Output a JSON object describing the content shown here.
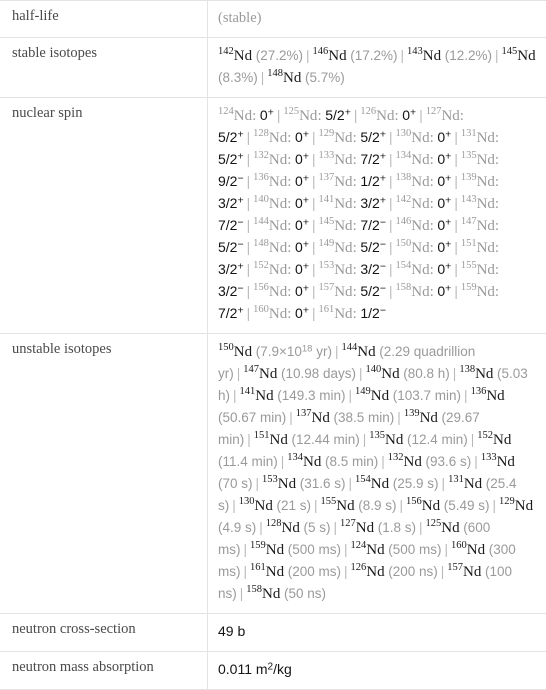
{
  "element": "Nd",
  "rows": [
    {
      "label": "half-life",
      "kind": "text",
      "value": "(stable)"
    },
    {
      "label": "stable isotopes",
      "kind": "isotope-list"
    },
    {
      "label": "nuclear spin",
      "kind": "spin-list"
    },
    {
      "label": "unstable isotopes",
      "kind": "isotope-list"
    },
    {
      "label": "neutron cross-section",
      "kind": "value",
      "value": "49 b"
    },
    {
      "label": "neutron mass absorption",
      "kind": "value",
      "value": "0.011 m",
      "sup": "2",
      "suffix": "/kg"
    }
  ],
  "half_life": {
    "label": "half-life",
    "value": "(stable)"
  },
  "stable_isotopes": {
    "label": "stable isotopes",
    "items": [
      {
        "mass": "142",
        "symbol": "Nd",
        "detail": "(27.2%)"
      },
      {
        "mass": "146",
        "symbol": "Nd",
        "detail": "(17.2%)"
      },
      {
        "mass": "143",
        "symbol": "Nd",
        "detail": "(12.2%)"
      },
      {
        "mass": "145",
        "symbol": "Nd",
        "detail": "(8.3%)"
      },
      {
        "mass": "148",
        "symbol": "Nd",
        "detail": "(5.7%)"
      }
    ]
  },
  "nuclear_spin": {
    "label": "nuclear spin",
    "items": [
      {
        "mass": "124",
        "symbol": "Nd",
        "spin": "0",
        "sign": "+"
      },
      {
        "mass": "125",
        "symbol": "Nd",
        "spin": "5/2",
        "sign": "+"
      },
      {
        "mass": "126",
        "symbol": "Nd",
        "spin": "0",
        "sign": "+"
      },
      {
        "mass": "127",
        "symbol": "Nd",
        "spin": "5/2",
        "sign": "+"
      },
      {
        "mass": "128",
        "symbol": "Nd",
        "spin": "0",
        "sign": "+"
      },
      {
        "mass": "129",
        "symbol": "Nd",
        "spin": "5/2",
        "sign": "+"
      },
      {
        "mass": "130",
        "symbol": "Nd",
        "spin": "0",
        "sign": "+"
      },
      {
        "mass": "131",
        "symbol": "Nd",
        "spin": "5/2",
        "sign": "+"
      },
      {
        "mass": "132",
        "symbol": "Nd",
        "spin": "0",
        "sign": "+"
      },
      {
        "mass": "133",
        "symbol": "Nd",
        "spin": "7/2",
        "sign": "+"
      },
      {
        "mass": "134",
        "symbol": "Nd",
        "spin": "0",
        "sign": "+"
      },
      {
        "mass": "135",
        "symbol": "Nd",
        "spin": "9/2",
        "sign": "−"
      },
      {
        "mass": "136",
        "symbol": "Nd",
        "spin": "0",
        "sign": "+"
      },
      {
        "mass": "137",
        "symbol": "Nd",
        "spin": "1/2",
        "sign": "+"
      },
      {
        "mass": "138",
        "symbol": "Nd",
        "spin": "0",
        "sign": "+"
      },
      {
        "mass": "139",
        "symbol": "Nd",
        "spin": "3/2",
        "sign": "+"
      },
      {
        "mass": "140",
        "symbol": "Nd",
        "spin": "0",
        "sign": "+"
      },
      {
        "mass": "141",
        "symbol": "Nd",
        "spin": "3/2",
        "sign": "+"
      },
      {
        "mass": "142",
        "symbol": "Nd",
        "spin": "0",
        "sign": "+"
      },
      {
        "mass": "143",
        "symbol": "Nd",
        "spin": "7/2",
        "sign": "−"
      },
      {
        "mass": "144",
        "symbol": "Nd",
        "spin": "0",
        "sign": "+"
      },
      {
        "mass": "145",
        "symbol": "Nd",
        "spin": "7/2",
        "sign": "−"
      },
      {
        "mass": "146",
        "symbol": "Nd",
        "spin": "0",
        "sign": "+"
      },
      {
        "mass": "147",
        "symbol": "Nd",
        "spin": "5/2",
        "sign": "−"
      },
      {
        "mass": "148",
        "symbol": "Nd",
        "spin": "0",
        "sign": "+"
      },
      {
        "mass": "149",
        "symbol": "Nd",
        "spin": "5/2",
        "sign": "−"
      },
      {
        "mass": "150",
        "symbol": "Nd",
        "spin": "0",
        "sign": "+"
      },
      {
        "mass": "151",
        "symbol": "Nd",
        "spin": "3/2",
        "sign": "+"
      },
      {
        "mass": "152",
        "symbol": "Nd",
        "spin": "0",
        "sign": "+"
      },
      {
        "mass": "153",
        "symbol": "Nd",
        "spin": "3/2",
        "sign": "−"
      },
      {
        "mass": "154",
        "symbol": "Nd",
        "spin": "0",
        "sign": "+"
      },
      {
        "mass": "155",
        "symbol": "Nd",
        "spin": "3/2",
        "sign": "−"
      },
      {
        "mass": "156",
        "symbol": "Nd",
        "spin": "0",
        "sign": "+"
      },
      {
        "mass": "157",
        "symbol": "Nd",
        "spin": "5/2",
        "sign": "−"
      },
      {
        "mass": "158",
        "symbol": "Nd",
        "spin": "0",
        "sign": "+"
      },
      {
        "mass": "159",
        "symbol": "Nd",
        "spin": "7/2",
        "sign": "+"
      },
      {
        "mass": "160",
        "symbol": "Nd",
        "spin": "0",
        "sign": "+"
      },
      {
        "mass": "161",
        "symbol": "Nd",
        "spin": "1/2",
        "sign": "−"
      }
    ]
  },
  "unstable_isotopes": {
    "label": "unstable isotopes",
    "items": [
      {
        "mass": "150",
        "symbol": "Nd",
        "detail": "(7.9×10",
        "exp": "18",
        "detail2": " yr)"
      },
      {
        "mass": "144",
        "symbol": "Nd",
        "detail": "(2.29 quadrillion yr)"
      },
      {
        "mass": "147",
        "symbol": "Nd",
        "detail": "(10.98 days)"
      },
      {
        "mass": "140",
        "symbol": "Nd",
        "detail": "(80.8 h)"
      },
      {
        "mass": "138",
        "symbol": "Nd",
        "detail": "(5.03 h)"
      },
      {
        "mass": "141",
        "symbol": "Nd",
        "detail": "(149.3 min)"
      },
      {
        "mass": "149",
        "symbol": "Nd",
        "detail": "(103.7 min)"
      },
      {
        "mass": "136",
        "symbol": "Nd",
        "detail": "(50.67 min)"
      },
      {
        "mass": "137",
        "symbol": "Nd",
        "detail": "(38.5 min)"
      },
      {
        "mass": "139",
        "symbol": "Nd",
        "detail": "(29.67 min)"
      },
      {
        "mass": "151",
        "symbol": "Nd",
        "detail": "(12.44 min)"
      },
      {
        "mass": "135",
        "symbol": "Nd",
        "detail": "(12.4 min)"
      },
      {
        "mass": "152",
        "symbol": "Nd",
        "detail": "(11.4 min)"
      },
      {
        "mass": "134",
        "symbol": "Nd",
        "detail": "(8.5 min)"
      },
      {
        "mass": "132",
        "symbol": "Nd",
        "detail": "(93.6 s)"
      },
      {
        "mass": "133",
        "symbol": "Nd",
        "detail": "(70 s)"
      },
      {
        "mass": "153",
        "symbol": "Nd",
        "detail": "(31.6 s)"
      },
      {
        "mass": "154",
        "symbol": "Nd",
        "detail": "(25.9 s)"
      },
      {
        "mass": "131",
        "symbol": "Nd",
        "detail": "(25.4 s)"
      },
      {
        "mass": "130",
        "symbol": "Nd",
        "detail": "(21 s)"
      },
      {
        "mass": "155",
        "symbol": "Nd",
        "detail": "(8.9 s)"
      },
      {
        "mass": "156",
        "symbol": "Nd",
        "detail": "(5.49 s)"
      },
      {
        "mass": "129",
        "symbol": "Nd",
        "detail": "(4.9 s)"
      },
      {
        "mass": "128",
        "symbol": "Nd",
        "detail": "(5 s)"
      },
      {
        "mass": "127",
        "symbol": "Nd",
        "detail": "(1.8 s)"
      },
      {
        "mass": "125",
        "symbol": "Nd",
        "detail": "(600 ms)"
      },
      {
        "mass": "159",
        "symbol": "Nd",
        "detail": "(500 ms)"
      },
      {
        "mass": "124",
        "symbol": "Nd",
        "detail": "(500 ms)"
      },
      {
        "mass": "160",
        "symbol": "Nd",
        "detail": "(300 ms)"
      },
      {
        "mass": "161",
        "symbol": "Nd",
        "detail": "(200 ms)"
      },
      {
        "mass": "126",
        "symbol": "Nd",
        "detail": "(200 ns)"
      },
      {
        "mass": "157",
        "symbol": "Nd",
        "detail": "(100 ns)"
      },
      {
        "mass": "158",
        "symbol": "Nd",
        "detail": "(50 ns)"
      }
    ]
  },
  "neutron_cross_section": {
    "label": "neutron cross-section",
    "value": "49 b"
  },
  "neutron_mass_absorption": {
    "label": "neutron mass absorption",
    "value_prefix": "0.011 m",
    "value_sup": "2",
    "value_suffix": "/kg"
  },
  "separator": "|",
  "colors": {
    "border": "#e3e3e3",
    "label_text": "#4a4a4a",
    "value_text": "#1a1a1a",
    "muted_text": "#9a9a9a",
    "separator": "#b8b8b8",
    "background": "#ffffff"
  }
}
